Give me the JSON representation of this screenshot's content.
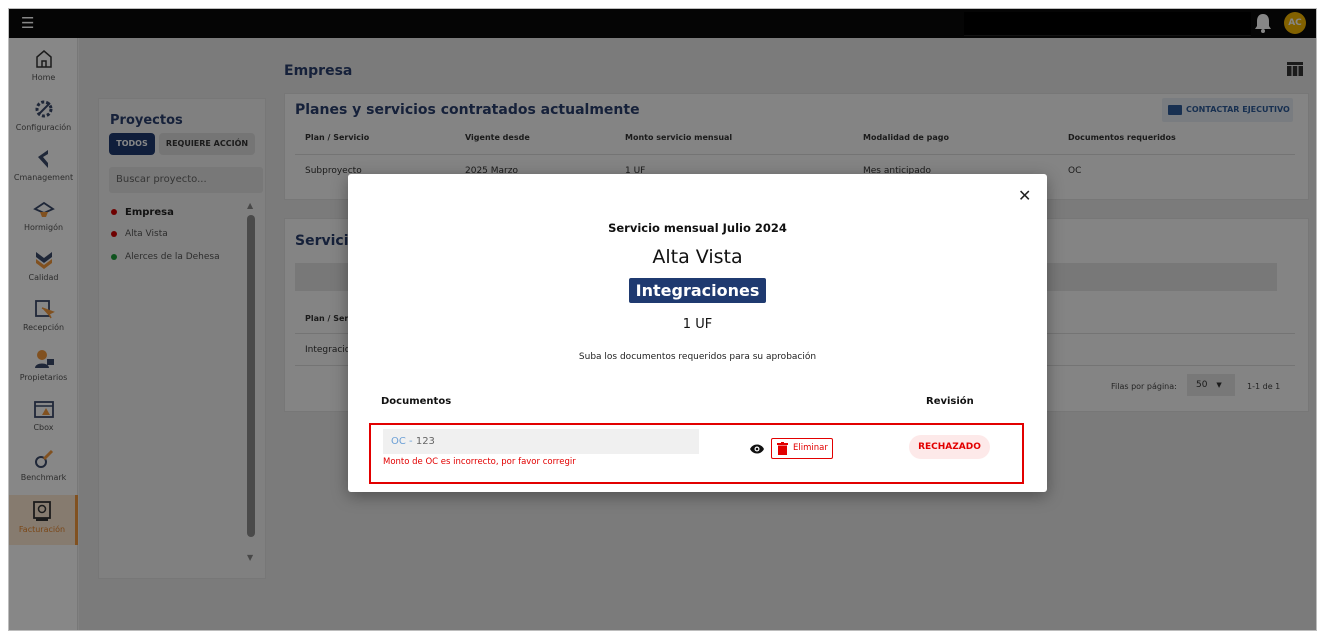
{
  "topbar": {
    "avatar_initials": "AC"
  },
  "nav": [
    {
      "label": "Home",
      "icon": "home-icon"
    },
    {
      "label": "Configuración",
      "icon": "settings-icon"
    },
    {
      "label": "Cmanagement",
      "icon": "cmanagement-icon"
    },
    {
      "label": "Hormigón",
      "icon": "concrete-icon"
    },
    {
      "label": "Calidad",
      "icon": "quality-icon"
    },
    {
      "label": "Recepción",
      "icon": "reception-icon"
    },
    {
      "label": "Propietarios",
      "icon": "owners-icon"
    },
    {
      "label": "Cbox",
      "icon": "cbox-icon"
    },
    {
      "label": "Benchmark",
      "icon": "benchmark-icon"
    },
    {
      "label": "Facturación",
      "icon": "billing-icon",
      "active": true
    }
  ],
  "projects": {
    "title": "Proyectos",
    "chip_all": "TODOS",
    "chip_action": "REQUIERE ACCIÓN",
    "search_placeholder": "Buscar proyecto...",
    "items": [
      {
        "name": "Empresa",
        "color": "#d00000"
      },
      {
        "name": "Alta Vista",
        "color": "#d00000"
      },
      {
        "name": "Alerces de la Dehesa",
        "color": "#1e9e3a"
      }
    ]
  },
  "page": {
    "title": "Empresa"
  },
  "plans_card": {
    "title": "Planes y servicios contratados actualmente",
    "contact_button": "CONTACTAR EJECUTIVO",
    "headers": [
      "Plan / Servicio",
      "Vigente desde",
      "Monto servicio mensual",
      "Modalidad de pago",
      "Documentos requeridos"
    ],
    "row": [
      "Subproyecto",
      "2025 Marzo",
      "1 UF",
      "Mes anticipado",
      "OC"
    ]
  },
  "services_card": {
    "title": "Servicio",
    "header_first": "Plan / Serv",
    "row_first": "Integracio",
    "rows_per_page_label": "Filas por página:",
    "rows_per_page_value": "50",
    "range": "1-1 de 1"
  },
  "modal": {
    "subtitle": "Servicio mensual Julio 2024",
    "title": "Alta Vista",
    "badge": "Integraciones",
    "amount": "1 UF",
    "instructions": "Suba los documentos requeridos para su aprobación",
    "col_documents": "Documentos",
    "col_review": "Revisión",
    "document": {
      "prefix": "OC -",
      "value": "123",
      "error": "Monto de OC es incorrecto, por favor corregir",
      "delete_label": "Eliminar",
      "status": "RECHAZADO"
    }
  },
  "colors": {
    "brand": "#1f3a70",
    "accent": "#f39a3d",
    "error": "#e20000"
  }
}
